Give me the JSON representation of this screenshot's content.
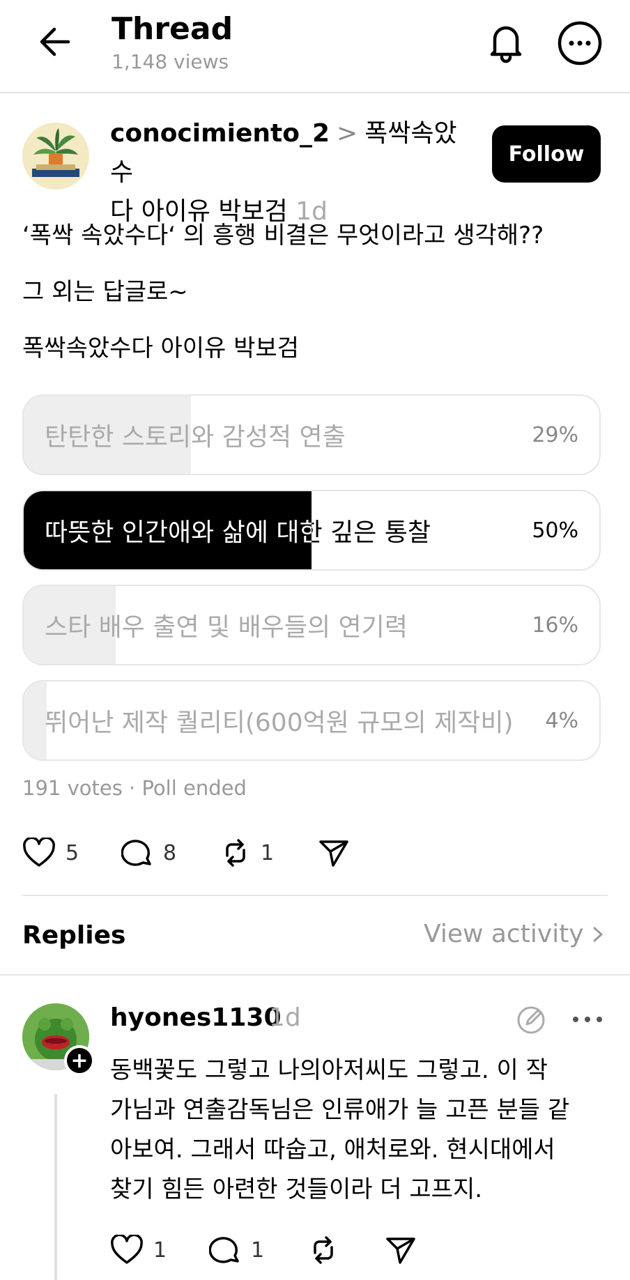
{
  "header": {
    "title": "Thread",
    "views": "1,148 views"
  },
  "post": {
    "username": "conocimiento_2",
    "topic_line1": "폭싹속았수",
    "topic_line2": "다 아이유 박보검",
    "time": "1d",
    "follow_label": "Follow",
    "lines": [
      "‘폭싹 속았수다‘ 의 흥행 비결은 무엇이라고 생각해??",
      "그 외는 답글로~",
      "폭싹속았수다 아이유 박보검"
    ]
  },
  "poll": {
    "options": [
      {
        "label": "탄탄한 스토리와 감성적 연출",
        "percent": "29%",
        "share": 0.29,
        "selected": false
      },
      {
        "label": "따뜻한 인간애와 삶에 대한 깊은 통찰",
        "percent": "50%",
        "share": 0.5,
        "selected": true
      },
      {
        "label": "스타 배우 출연 및 배우들의 연기력",
        "percent": "16%",
        "share": 0.16,
        "selected": false
      },
      {
        "label": "뛰어난 제작 퀄리티(600억원 규모의 제작비)",
        "percent": "4%",
        "share": 0.04,
        "selected": false
      }
    ],
    "votes": "191 votes",
    "separator": "·",
    "status": "Poll ended"
  },
  "actions": {
    "likes": "5",
    "comments": "8",
    "reposts": "1"
  },
  "replies_section": {
    "title": "Replies",
    "view_activity": "View activity"
  },
  "reply": {
    "username": "hyones1130",
    "time": "1d",
    "lines": [
      "동백꽃도 그렇고 나의아저씨도 그렇고.  이 작",
      "가님과 연출감독님은 인류애가 늘 고픈 분들 같",
      "아보여.  그래서 따숩고, 애처로와. 현시대에서",
      "찾기 힘든 아련한 것들이라 더 고프지."
    ],
    "likes": "1",
    "comments": "1"
  },
  "icons": {
    "back": "arrow-left-icon",
    "bell": "bell-icon",
    "more": "more-horizontal-icon",
    "heart": "heart-icon",
    "comment": "comment-icon",
    "repost": "repost-icon",
    "share": "send-icon",
    "edit": "edit-icon"
  }
}
